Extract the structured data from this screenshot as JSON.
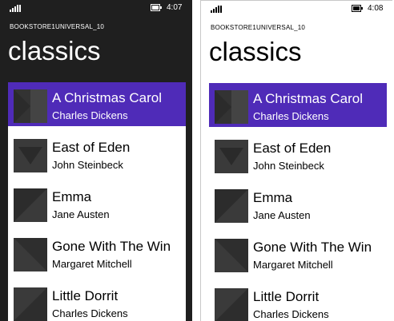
{
  "status": {
    "time_left": "4:07",
    "time_right": "4:08"
  },
  "app": {
    "name": "BOOKSTORE1UNIVERSAL_10"
  },
  "page": {
    "title": "classics"
  },
  "colors": {
    "accent": "#4f2bb8",
    "dark_bg": "#1f1f1f",
    "thumb": "#3a3a3a"
  },
  "books": [
    {
      "title": "A Christmas Carol",
      "author": "Charles Dickens"
    },
    {
      "title": "East of Eden",
      "author": "John Steinbeck"
    },
    {
      "title": "Emma",
      "author": "Jane Austen"
    },
    {
      "title": "Gone With The Win",
      "author": "Margaret Mitchell"
    },
    {
      "title": "Little Dorrit",
      "author": "Charles Dickens"
    }
  ],
  "icons": {
    "signal": "signal-strength-icon",
    "battery": "battery-icon",
    "cover": "book-cover-placeholder-icon"
  }
}
